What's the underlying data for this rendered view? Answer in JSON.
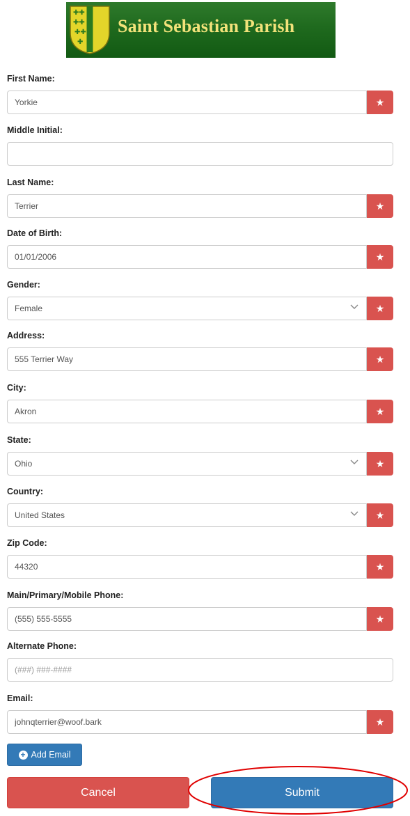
{
  "header": {
    "parish_name": "Saint Sebastian Parish"
  },
  "form": {
    "first_name": {
      "label": "First Name:",
      "value": "Yorkie",
      "required": true
    },
    "middle_initial": {
      "label": "Middle Initial:",
      "value": ""
    },
    "last_name": {
      "label": "Last Name:",
      "value": "Terrier",
      "required": true
    },
    "dob": {
      "label": "Date of Birth:",
      "value": "01/01/2006",
      "required": true
    },
    "gender": {
      "label": "Gender:",
      "value": "Female",
      "required": true
    },
    "address": {
      "label": "Address:",
      "value": "555 Terrier Way",
      "required": true
    },
    "city": {
      "label": "City:",
      "value": "Akron",
      "required": true
    },
    "state": {
      "label": "State:",
      "value": "Ohio",
      "required": true
    },
    "country": {
      "label": "Country:",
      "value": "United States",
      "required": true
    },
    "zip": {
      "label": "Zip Code:",
      "value": "44320",
      "required": true
    },
    "phone": {
      "label": "Main/Primary/Mobile Phone:",
      "value": "(555) 555-5555",
      "required": true
    },
    "alt_phone": {
      "label": "Alternate Phone:",
      "value": "",
      "placeholder": "(###) ###-####"
    },
    "email": {
      "label": "Email:",
      "value": "johnqterrier@woof.bark",
      "required": true
    },
    "required_glyph": "★"
  },
  "actions": {
    "add_email": "Add Email",
    "cancel": "Cancel",
    "submit": "Submit"
  },
  "colors": {
    "required": "#d9534f",
    "primary": "#337ab7",
    "banner_green": "#1f6a1e",
    "banner_text": "#f2e27a",
    "annotation": "#e00000"
  }
}
